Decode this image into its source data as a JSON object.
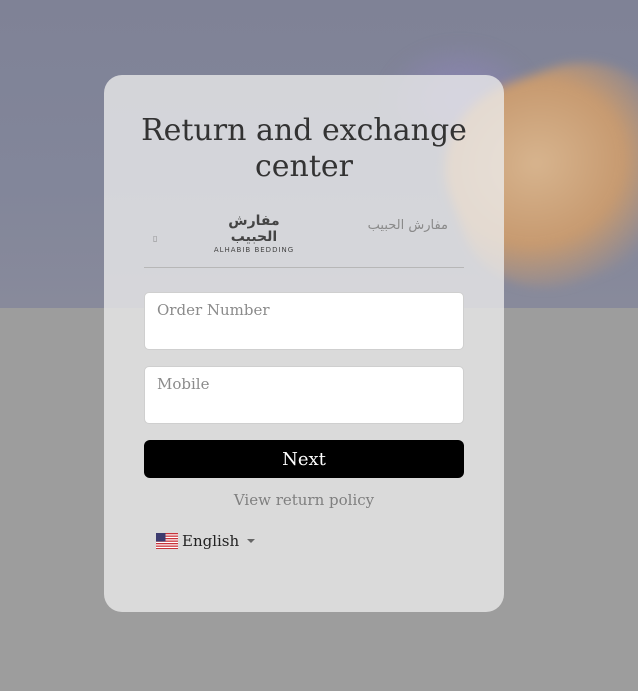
{
  "card": {
    "title": "Return and exchange center"
  },
  "brand_tabs": {
    "marker": "▯",
    "logo_arabic": "مفارش الحبيب",
    "logo_english": "ALHABIB BEDDING",
    "tab_arabic_label": "مفارش الحبيب"
  },
  "form": {
    "order_number_label": "Order Number",
    "order_number_value": "",
    "mobile_label": "Mobile",
    "mobile_value": "",
    "next_label": "Next"
  },
  "links": {
    "view_policy": "View return policy"
  },
  "language": {
    "selected": "English",
    "flag_icon": "us-flag-icon",
    "caret_icon": "chevron-down-icon"
  },
  "colors": {
    "button_bg": "#000000",
    "button_text": "#ffffff",
    "card_bg": "#ececec"
  }
}
